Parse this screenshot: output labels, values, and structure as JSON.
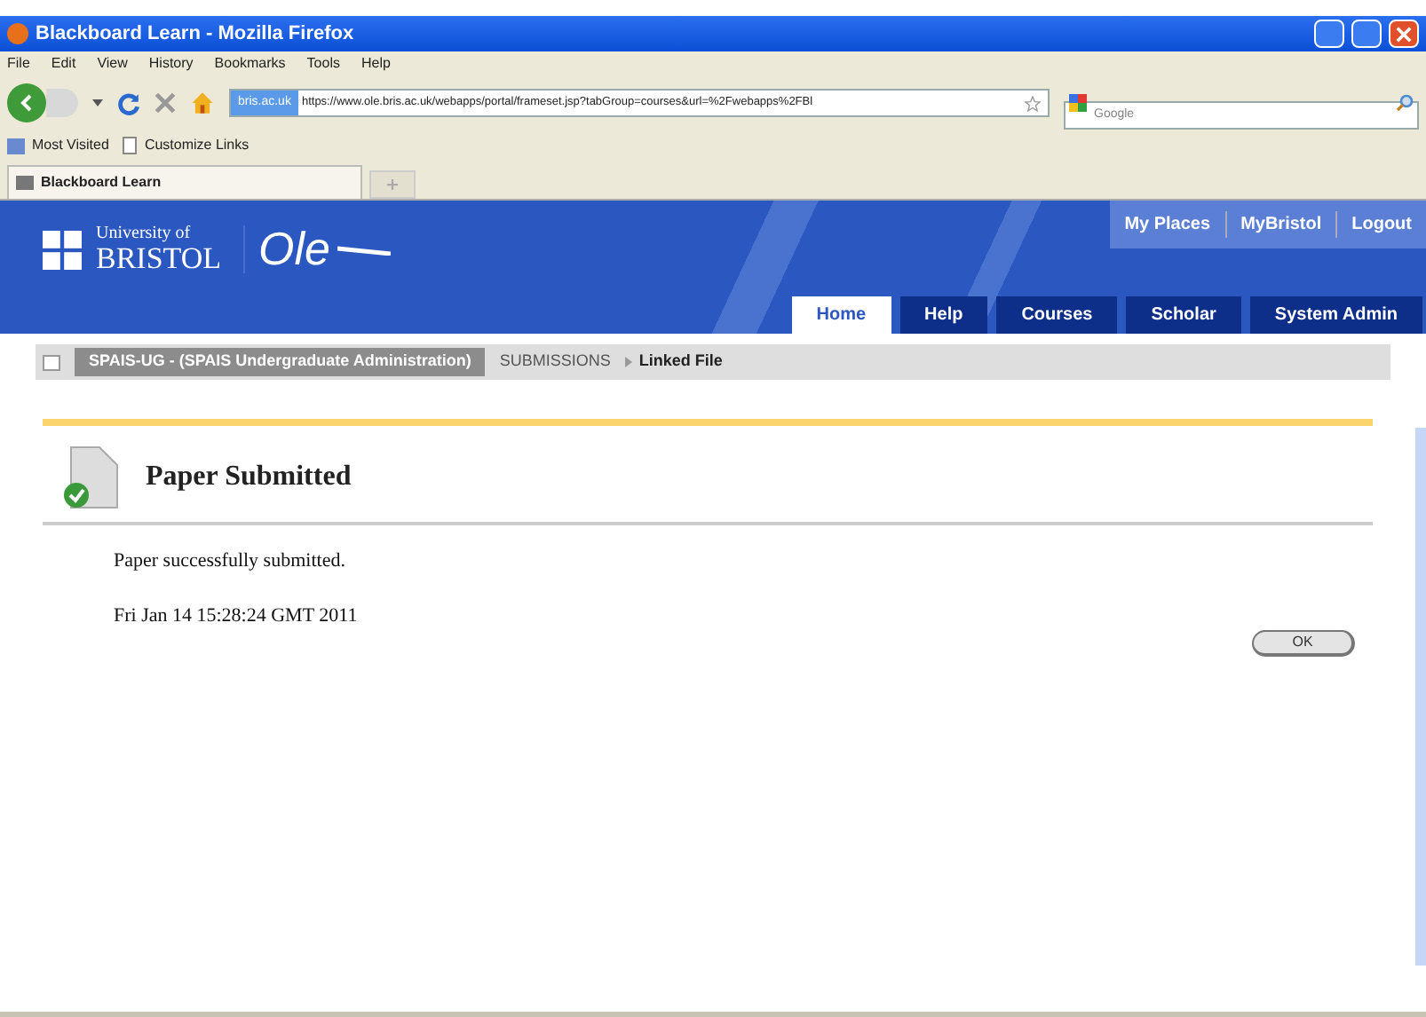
{
  "window": {
    "title": "Blackboard Learn - Mozilla Firefox"
  },
  "menu": [
    "File",
    "Edit",
    "View",
    "History",
    "Bookmarks",
    "Tools",
    "Help"
  ],
  "address": {
    "identity": "bris.ac.uk",
    "url": "https://www.ole.bris.ac.uk/webapps/portal/frameset.jsp?tabGroup=courses&url=%2Fwebapps%2FBl"
  },
  "search": {
    "placeholder": "Google"
  },
  "bookmarks": [
    "Most Visited",
    "Customize Links"
  ],
  "browser_tabs": [
    {
      "label": "Blackboard Learn",
      "selected": true
    }
  ],
  "header": {
    "logo_line1": "University of",
    "logo_line2": "BRISTOL",
    "brand": "Ole",
    "top_links": [
      "My Places",
      "MyBristol",
      "Logout"
    ],
    "tabs": [
      {
        "label": "Home",
        "selected": true
      },
      {
        "label": "Help",
        "selected": false
      },
      {
        "label": "Courses",
        "selected": false
      },
      {
        "label": "Scholar",
        "selected": false
      },
      {
        "label": "System Admin",
        "selected": false
      }
    ]
  },
  "breadcrumb": {
    "course": "SPAIS-UG - (SPAIS Undergraduate Administration)",
    "items": [
      "SUBMISSIONS",
      "Linked File"
    ]
  },
  "receipt": {
    "title": "Paper Submitted",
    "message": "Paper successfully submitted.",
    "timestamp": "Fri Jan 14 15:28:24 GMT 2011",
    "button": "OK"
  }
}
